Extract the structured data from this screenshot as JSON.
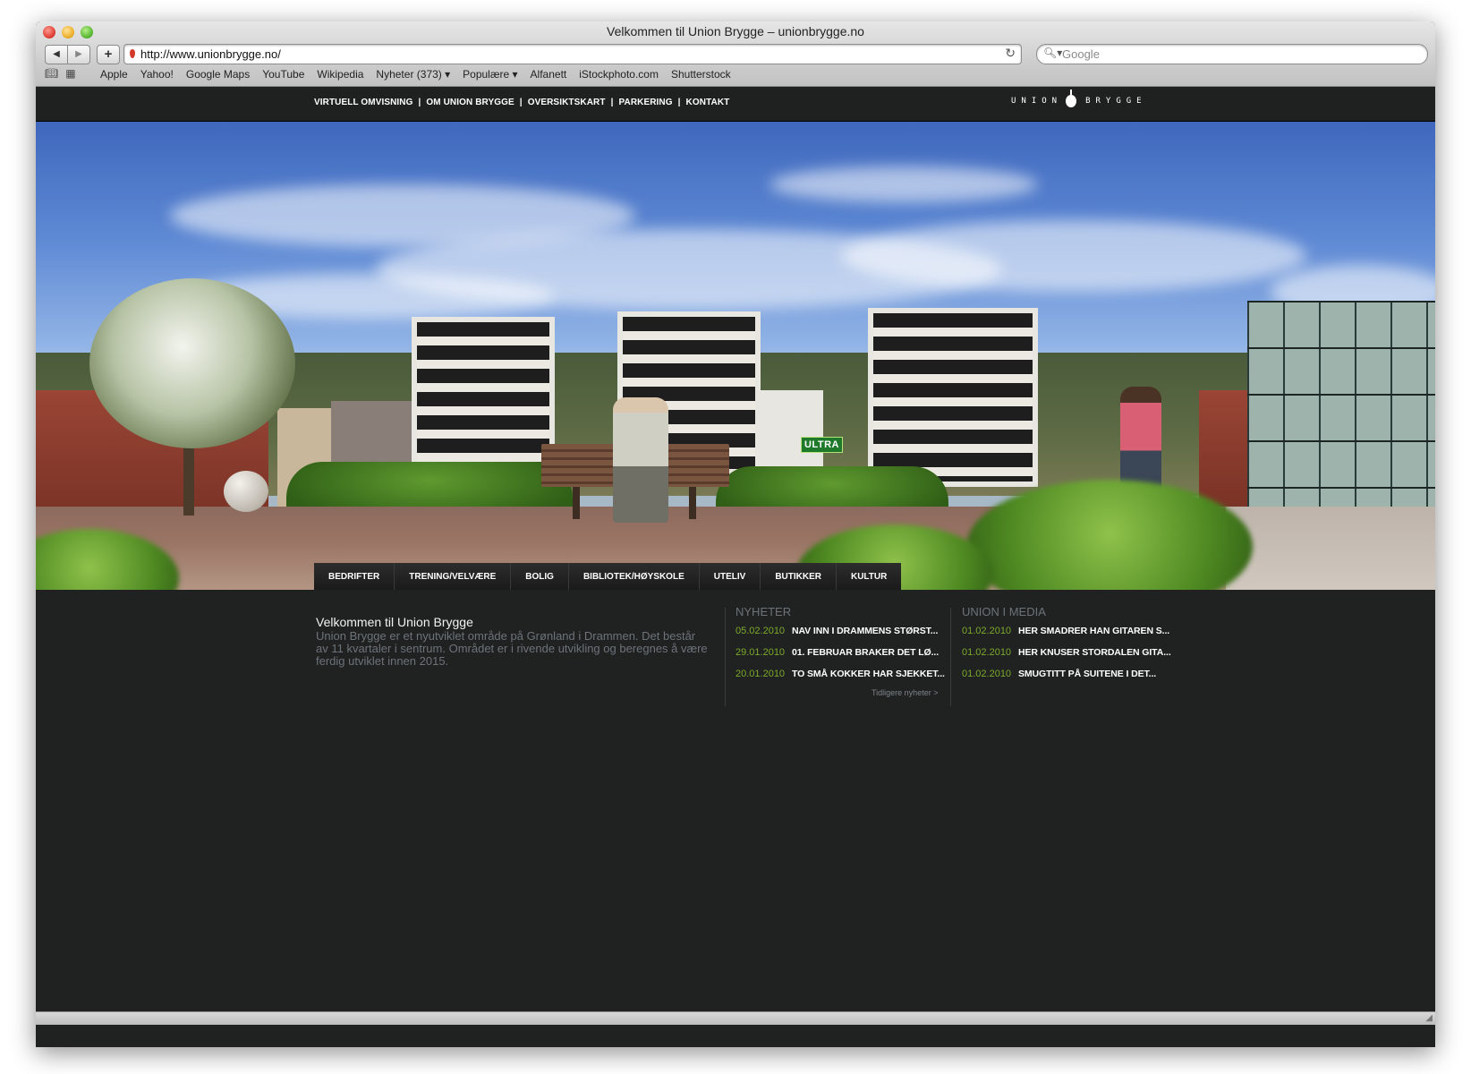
{
  "browser": {
    "window_title": "Velkommen til Union Brygge – unionbrygge.no",
    "url": "http://www.unionbrygge.no/",
    "search_placeholder": "Google",
    "bookmarks": [
      "Apple",
      "Yahoo!",
      "Google Maps",
      "YouTube",
      "Wikipedia",
      "Nyheter (373) ▾",
      "Populære ▾",
      "Alfanett",
      "iStockphoto.com",
      "Shutterstock"
    ]
  },
  "site": {
    "top_nav": [
      "VIRTUELL OMVISNING",
      "OM UNION BRYGGE",
      "OVERSIKTSKART",
      "PARKERING",
      "KONTAKT"
    ],
    "logo_left": "UNION",
    "logo_right": "BRYGGE",
    "category_tabs": [
      "BEDRIFTER",
      "TRENING/VELVÆRE",
      "BOLIG",
      "BIBLIOTEK/HØYSKOLE",
      "UTELIV",
      "BUTIKKER",
      "KULTUR"
    ],
    "hero_sign": "ULTRA",
    "welcome": {
      "title": "Velkommen til Union Brygge",
      "body": "Union Brygge er et nyutviklet område på Grønland i Drammen. Det består av 11 kvartaler i sentrum. Området er i rivende utvikling og beregnes å være ferdig utviklet innen 2015."
    },
    "news": {
      "title": "NYHETER",
      "items": [
        {
          "date": "05.02.2010",
          "text": "NAV INN I DRAMMENS STØRST..."
        },
        {
          "date": "29.01.2010",
          "text": "01. FEBRUAR BRAKER DET LØ..."
        },
        {
          "date": "20.01.2010",
          "text": "TO SMÅ KOKKER HAR SJEKKET..."
        }
      ],
      "more": "Tidligere nyheter >"
    },
    "media": {
      "title": "UNION I MEDIA",
      "items": [
        {
          "date": "01.02.2010",
          "text": "HER SMADRER HAN GITAREN S..."
        },
        {
          "date": "01.02.2010",
          "text": "HER KNUSER STORDALEN GITA..."
        },
        {
          "date": "01.02.2010",
          "text": "SMUGTITT PÅ SUITENE I DET..."
        }
      ]
    }
  },
  "colors": {
    "page_bg": "#202121",
    "date_green": "#7dab2b",
    "muted_text": "#6c747a"
  }
}
